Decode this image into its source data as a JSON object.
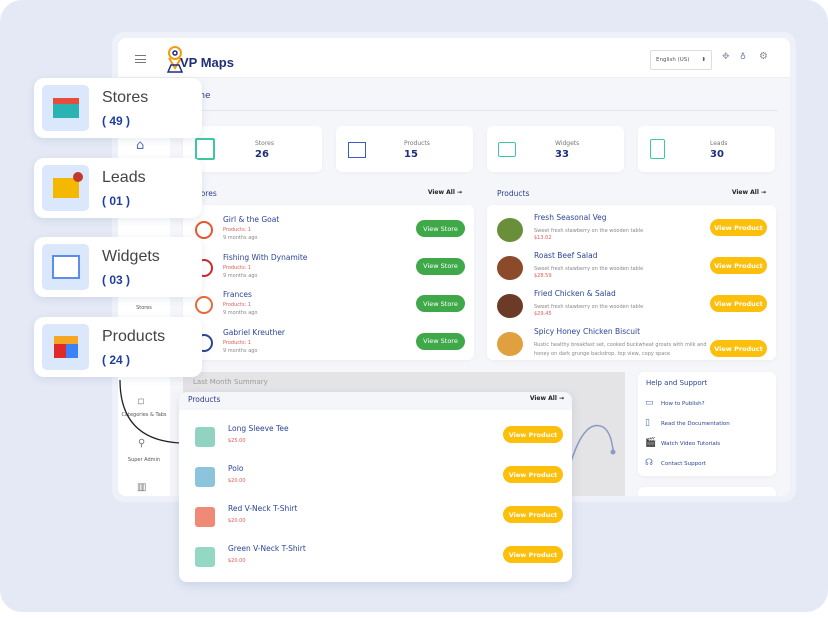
{
  "header": {
    "logo": "VP Maps",
    "language": "English (US)",
    "icons": [
      "menu-icon",
      "move-icon",
      "bulb-icon",
      "settings-icon"
    ]
  },
  "page_title": "Home",
  "sidebar": {
    "items": [
      {
        "label": "",
        "icon": "home-icon"
      },
      {
        "label": "Stores",
        "icon": "store-icon"
      },
      {
        "label": "Categories & Tabs",
        "icon": "tag-icon"
      },
      {
        "label": "Super Admin",
        "icon": "user-icon"
      },
      {
        "label": "",
        "icon": "chart-icon"
      }
    ]
  },
  "stats": [
    {
      "label": "Stores",
      "value": "26"
    },
    {
      "label": "Products",
      "value": "15"
    },
    {
      "label": "Widgets",
      "value": "33"
    },
    {
      "label": "Leads",
      "value": "30"
    }
  ],
  "stores_panel": {
    "title": "Stores",
    "view_all": "View All →",
    "button": "View Store",
    "rows": [
      {
        "name": "Girl & the Goat",
        "products": "Products: 1",
        "time": "9 months ago"
      },
      {
        "name": "Fishing With Dynamite",
        "products": "Products: 1",
        "time": "9 months ago"
      },
      {
        "name": "Frances",
        "products": "Products: 1",
        "time": "9 months ago"
      },
      {
        "name": "Gabriel Kreuther",
        "products": "Products: 1",
        "time": "9 months ago"
      }
    ]
  },
  "products_panel": {
    "title": "Products",
    "view_all": "View All →",
    "button": "View Product",
    "rows": [
      {
        "name": "Fresh Seasonal Veg",
        "desc": "Sweet fresh stawberry on the wooden table",
        "price": "$13.02"
      },
      {
        "name": "Roast Beef Salad",
        "desc": "Sweet fresh stawberry on the wooden table",
        "price": "$28.59"
      },
      {
        "name": "Fried Chicken & Salad",
        "desc": "Sweet fresh stawberry on the wooden table",
        "price": "$29.45"
      },
      {
        "name": "Spicy Honey Chicken Biscuit",
        "desc": "Rustic healthy breakfast set, cooked buckwheat groats with milk and honey on dark grunge backdrop. top view, copy space",
        "price": ""
      }
    ]
  },
  "summary": {
    "title": "Last Month Summary"
  },
  "help": {
    "title": "Help and Support",
    "items": [
      {
        "label": "How to Publish?",
        "icon": "browser-icon"
      },
      {
        "label": "Read the Documentation",
        "icon": "document-icon"
      },
      {
        "label": "Watch Video Tutorials",
        "icon": "clapper-icon"
      },
      {
        "label": "Contact Support",
        "icon": "headset-icon"
      }
    ]
  },
  "floating_cards": [
    {
      "title": "Stores",
      "count": "( 49 )",
      "icon": "storefront-icon"
    },
    {
      "title": "Leads",
      "count": "( 01 )",
      "icon": "mail-notification-icon"
    },
    {
      "title": "Widgets",
      "count": "( 03 )",
      "icon": "widget-grid-icon"
    },
    {
      "title": "Products",
      "count": "( 24 )",
      "icon": "cubes-icon"
    }
  ],
  "floating_products": {
    "title": "Products",
    "view_all": "View All →",
    "button": "View Product",
    "rows": [
      {
        "name": "Long Sleeve Tee",
        "price": "$25.00",
        "color": "#8fd3c0"
      },
      {
        "name": "Polo",
        "price": "$20.00",
        "color": "#8cc4dc"
      },
      {
        "name": "Red V-Neck T-Shirt",
        "price": "$20.00",
        "color": "#ef8a76"
      },
      {
        "name": "Green V-Neck T-Shirt",
        "price": "$20.00",
        "color": "#92d8c2"
      }
    ]
  },
  "colors": {
    "green_button": "#3fa848",
    "yellow_button": "#fbbf0c",
    "brand_blue": "#1e2f7a",
    "brand_orange": "#f39c12"
  }
}
